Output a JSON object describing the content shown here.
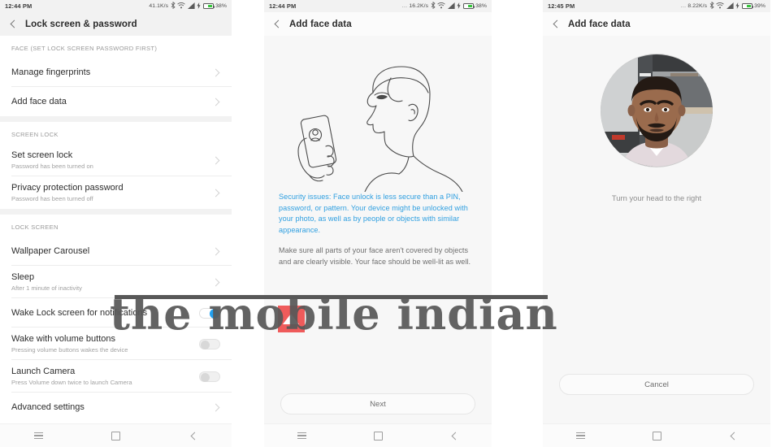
{
  "panels": [
    {
      "id": "lock-screen-settings",
      "statusbar": {
        "time": "12:44 PM",
        "netspeed": "41.1K/s",
        "battery_pct": "38%",
        "icons": [
          "bluetooth-icon",
          "wifi-icon",
          "signal-icon",
          "charging-bolt-icon",
          "battery-icon"
        ]
      },
      "appbar": {
        "title": "Lock screen & password",
        "back": "back-chevron-icon"
      },
      "sections": [
        {
          "header": "FACE (SET LOCK SCREEN PASSWORD FIRST)",
          "rows": [
            {
              "title": "Manage fingerprints",
              "sub": "",
              "control": "chevron"
            },
            {
              "title": "Add face data",
              "sub": "",
              "control": "chevron"
            }
          ]
        },
        {
          "header": "SCREEN LOCK",
          "rows": [
            {
              "title": "Set screen lock",
              "sub": "Password has been turned on",
              "control": "chevron"
            },
            {
              "title": "Privacy protection password",
              "sub": "Password has been turned off",
              "control": "chevron"
            }
          ]
        },
        {
          "header": "LOCK SCREEN",
          "rows": [
            {
              "title": "Wallpaper Carousel",
              "sub": "",
              "control": "chevron"
            },
            {
              "title": "Sleep",
              "sub": "After 1 minute of inactivity",
              "control": "chevron"
            },
            {
              "title": "Wake Lock screen for notifications",
              "sub": "",
              "control": "toggle-on"
            },
            {
              "title": "Wake with volume buttons",
              "sub": "Pressing volume buttons wakes the device",
              "control": "toggle-off"
            },
            {
              "title": "Launch Camera",
              "sub": "Press Volume down twice to launch Camera",
              "control": "toggle-off"
            },
            {
              "title": "Advanced settings",
              "sub": "",
              "control": "chevron"
            }
          ]
        }
      ],
      "navbar": [
        "menu-icon",
        "home-icon",
        "back-icon"
      ]
    },
    {
      "id": "add-face-data-intro",
      "statusbar": {
        "time": "12:44 PM",
        "netspeed": "16.2K/s",
        "battery_pct": "38%",
        "icons": [
          "bluetooth-icon",
          "wifi-icon",
          "signal-icon",
          "charging-bolt-icon",
          "battery-icon"
        ]
      },
      "appbar": {
        "title": "Add face data",
        "back": "back-chevron-icon"
      },
      "illustration": "face-unlock-profile-illustration",
      "warning_text": "Security issues: Face unlock is less secure than a PIN, password, or pattern. Your device might be unlocked with your photo, as well as by people or objects with similar appearance.",
      "note_text": "Make sure all parts of your face aren't covered by objects and are clearly visible. Your face should be well-lit as well.",
      "primary_button": "Next",
      "navbar": [
        "menu-icon",
        "home-icon",
        "back-icon"
      ]
    },
    {
      "id": "add-face-data-capture",
      "statusbar": {
        "time": "12:45 PM",
        "netspeed": "8.22K/s",
        "battery_pct": "39%",
        "icons": [
          "bluetooth-icon",
          "wifi-icon",
          "signal-icon",
          "charging-bolt-icon",
          "battery-icon"
        ]
      },
      "appbar": {
        "title": "Add face data",
        "back": "back-chevron-icon"
      },
      "preview": "camera-face-preview",
      "hint_text": "Turn your head to the right",
      "primary_button": "Cancel",
      "navbar": [
        "menu-icon",
        "home-icon",
        "back-icon"
      ]
    }
  ],
  "watermark": {
    "text": "the mobile indian",
    "accent_color": "#ef5b5b"
  },
  "colors": {
    "toggle_on": "#20a0f0",
    "warning_blue": "#2f9fe0",
    "battery_green": "#35c43b"
  }
}
